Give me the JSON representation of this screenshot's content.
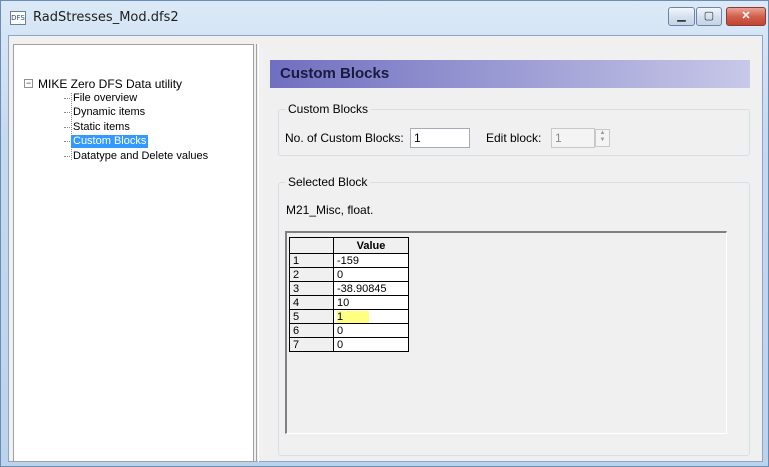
{
  "window": {
    "title": "RadStresses_Mod.dfs2",
    "app_icon_text": "DFS",
    "buttons": {
      "minimize": "▁",
      "maximize": "▢",
      "close": "✕"
    }
  },
  "tree": {
    "root": {
      "expander": "−",
      "label": "MIKE Zero DFS Data utility"
    },
    "items": [
      {
        "label": "File overview",
        "selected": false
      },
      {
        "label": "Dynamic items",
        "selected": false
      },
      {
        "label": "Static items",
        "selected": false
      },
      {
        "label": "Custom Blocks",
        "selected": true
      },
      {
        "label": "Datatype and Delete values",
        "selected": false
      }
    ]
  },
  "header": {
    "title": "Custom Blocks"
  },
  "custom_blocks_group": {
    "legend": "Custom Blocks",
    "count_label": "No. of Custom Blocks:",
    "count_value": "1",
    "edit_label": "Edit block:",
    "edit_value": "1"
  },
  "selected_block_group": {
    "legend": "Selected Block",
    "description": "M21_Misc, float."
  },
  "grid": {
    "column_header": "Value",
    "rows": [
      {
        "index": "1",
        "value": "-159"
      },
      {
        "index": "2",
        "value": "0"
      },
      {
        "index": "3",
        "value": "-38.90845"
      },
      {
        "index": "4",
        "value": "10"
      },
      {
        "index": "5",
        "value": "1",
        "highlighted": true,
        "highlight_color": "#ffff80"
      },
      {
        "index": "6",
        "value": "0"
      },
      {
        "index": "7",
        "value": "0"
      }
    ]
  },
  "colors": {
    "selection": "#3399ff",
    "header_gradient_start": "#6f6fc0"
  }
}
